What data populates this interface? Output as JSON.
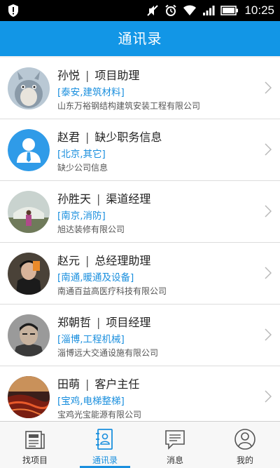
{
  "status_bar": {
    "time": "10:25",
    "icons": [
      "shield-icon",
      "mute-icon",
      "alarm-icon",
      "wifi-icon",
      "signal-icon",
      "battery-icon"
    ]
  },
  "header": {
    "title": "通讯录"
  },
  "contacts": [
    {
      "name": "孙悦",
      "title": "项目助理",
      "tags": "[泰安,建筑材料]",
      "company": "山东万裕钢结构建筑安装工程有限公司",
      "avatar": "totoro-avatar"
    },
    {
      "name": "赵君",
      "title": "缺少职务信息",
      "tags": "[北京,其它]",
      "company": "缺少公司信息",
      "avatar": "default-person-avatar"
    },
    {
      "name": "孙胜天",
      "title": "渠道经理",
      "tags": "[南京,消防]",
      "company": "旭达装修有限公司",
      "avatar": "photo-avatar"
    },
    {
      "name": "赵元",
      "title": "总经理助理",
      "tags": "[南通,暖通及设备]",
      "company": "南通百益高医疗科技有限公司",
      "avatar": "photo-avatar"
    },
    {
      "name": "郑朝哲",
      "title": "项目经理",
      "tags": "[淄博,工程机械]",
      "company": "淄博远大交通设施有限公司",
      "avatar": "photo-avatar"
    },
    {
      "name": "田萌",
      "title": "客户主任",
      "tags": "[宝鸡,电梯整梯]",
      "company": "宝鸡光宝能源有限公司",
      "avatar": "photo-avatar"
    }
  ],
  "tabs": [
    {
      "label": "找项目",
      "icon": "newspaper-icon"
    },
    {
      "label": "通讯录",
      "icon": "contacts-book-icon",
      "active": true
    },
    {
      "label": "消息",
      "icon": "message-icon"
    },
    {
      "label": "我的",
      "icon": "user-icon"
    }
  ],
  "colors": {
    "accent": "#1296e6",
    "tag": "#1a8fde"
  }
}
